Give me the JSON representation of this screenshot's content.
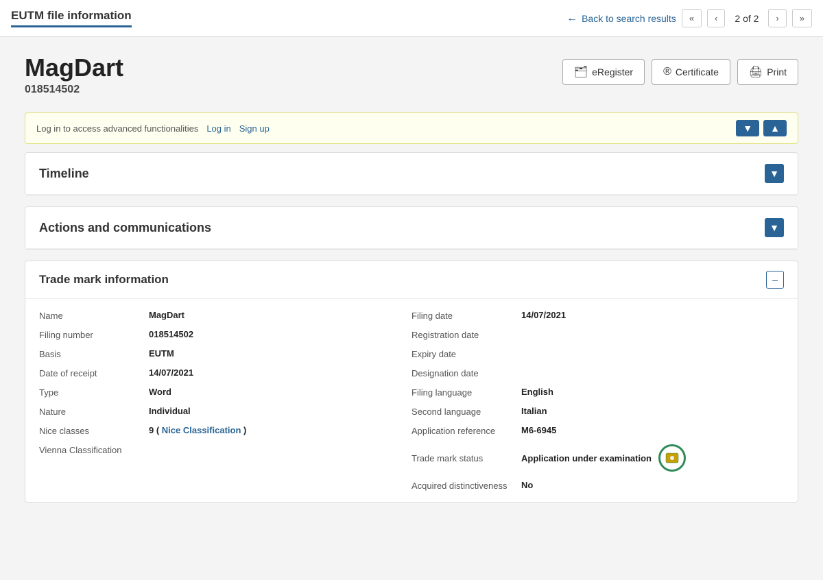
{
  "header": {
    "title": "EUTM file information",
    "back_label": "Back to search results",
    "page_indicator": "2 of 2"
  },
  "nav": {
    "first_label": "«",
    "prev_label": "‹",
    "next_label": "›",
    "last_label": "»"
  },
  "mark": {
    "name": "MagDart",
    "filing_number": "018514502"
  },
  "buttons": {
    "eregister": "eRegister",
    "certificate": "Certificate",
    "print": "Print"
  },
  "login_banner": {
    "text": "Log in to access advanced functionalities",
    "login_label": "Log in",
    "signup_label": "Sign up"
  },
  "sections": {
    "timeline": "Timeline",
    "actions": "Actions and communications"
  },
  "trade_mark": {
    "section_title": "Trade mark information",
    "left_fields": [
      {
        "label": "Name",
        "value": "MagDart",
        "bold": true
      },
      {
        "label": "Filing number",
        "value": "018514502",
        "bold": true
      },
      {
        "label": "Basis",
        "value": "EUTM",
        "bold": true
      },
      {
        "label": "Date of receipt",
        "value": "14/07/2021",
        "bold": true
      },
      {
        "label": "Type",
        "value": "Word",
        "bold": true
      },
      {
        "label": "Nature",
        "value": "Individual",
        "bold": true
      },
      {
        "label": "Nice classes",
        "value": "9 (",
        "link": "Nice Classification",
        "value_after": " )",
        "bold": true
      },
      {
        "label": "Vienna Classification",
        "value": "",
        "bold": false
      }
    ],
    "right_fields": [
      {
        "label": "Filing date",
        "value": "14/07/2021",
        "bold": true
      },
      {
        "label": "Registration date",
        "value": "",
        "bold": false
      },
      {
        "label": "Expiry date",
        "value": "",
        "bold": false
      },
      {
        "label": "Designation date",
        "value": "",
        "bold": false
      },
      {
        "label": "Filing language",
        "value": "English",
        "bold": true
      },
      {
        "label": "Second language",
        "value": "Italian",
        "bold": true
      },
      {
        "label": "Application reference",
        "value": "M6-6945",
        "bold": true
      },
      {
        "label": "Trade mark status",
        "value": "Application under examination",
        "bold": true
      },
      {
        "label": "Acquired distinctiveness",
        "value": "No",
        "bold": true
      }
    ]
  }
}
